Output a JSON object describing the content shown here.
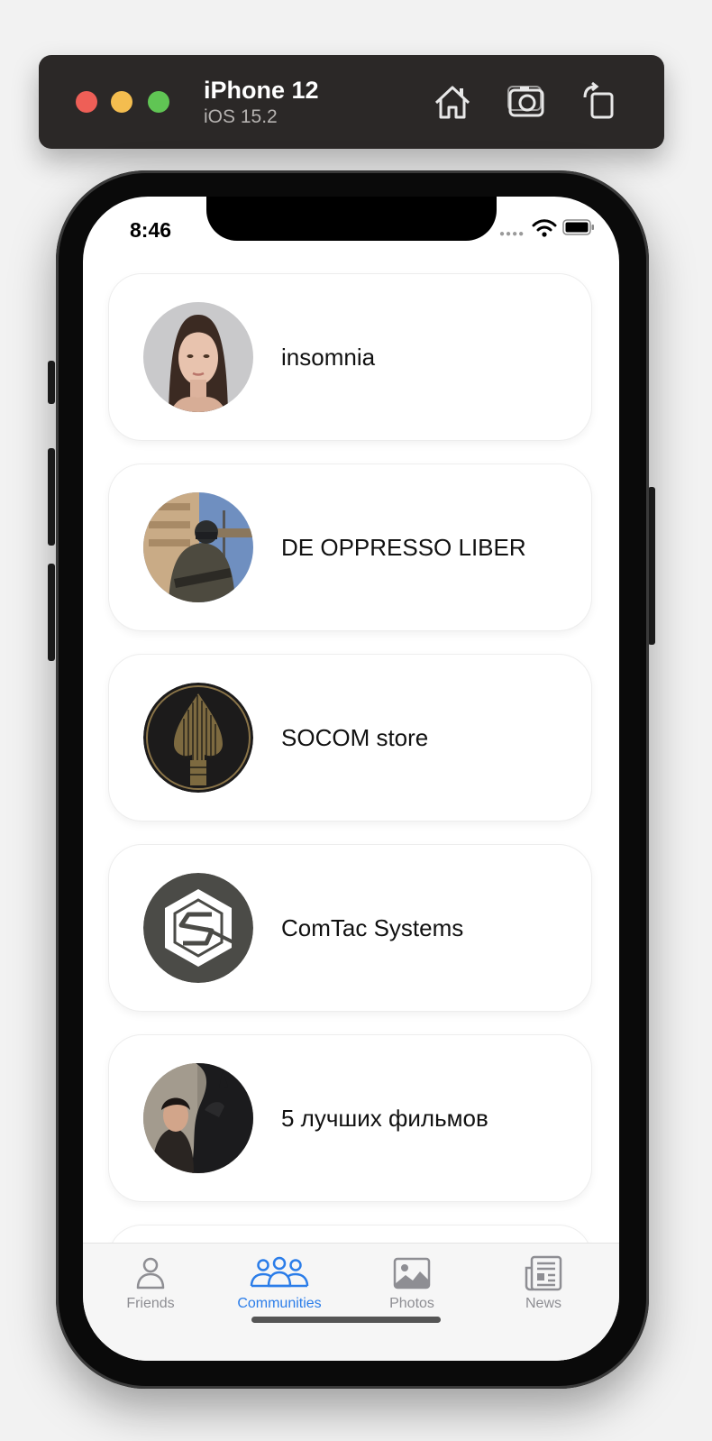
{
  "simulator": {
    "device_name": "iPhone 12",
    "os_version": "iOS 15.2",
    "toolbar_icons": [
      "home-icon",
      "screenshot-icon",
      "rotate-icon"
    ]
  },
  "status_bar": {
    "time": "8:46"
  },
  "communities": [
    {
      "name": "insomnia",
      "avatar": "portrait-avatar"
    },
    {
      "name": "DE OPPRESSO LIBER",
      "avatar": "soldier-avatar"
    },
    {
      "name": "SOCOM store",
      "avatar": "spearhead-emblem-avatar"
    },
    {
      "name": "ComTac Systems",
      "avatar": "hexagon-logo-avatar"
    },
    {
      "name": "5 лучших фильмов",
      "avatar": "movie-scene-avatar"
    }
  ],
  "tabbar": {
    "tabs": [
      {
        "label": "Friends",
        "icon": "person-icon"
      },
      {
        "label": "Communities",
        "icon": "group-icon"
      },
      {
        "label": "Photos",
        "icon": "photo-icon"
      },
      {
        "label": "News",
        "icon": "newspaper-icon"
      }
    ],
    "active": "Communities"
  },
  "colors": {
    "accent": "#2b7de9",
    "inactive": "#8e8e93",
    "toolbar_bg": "#2b2827"
  }
}
